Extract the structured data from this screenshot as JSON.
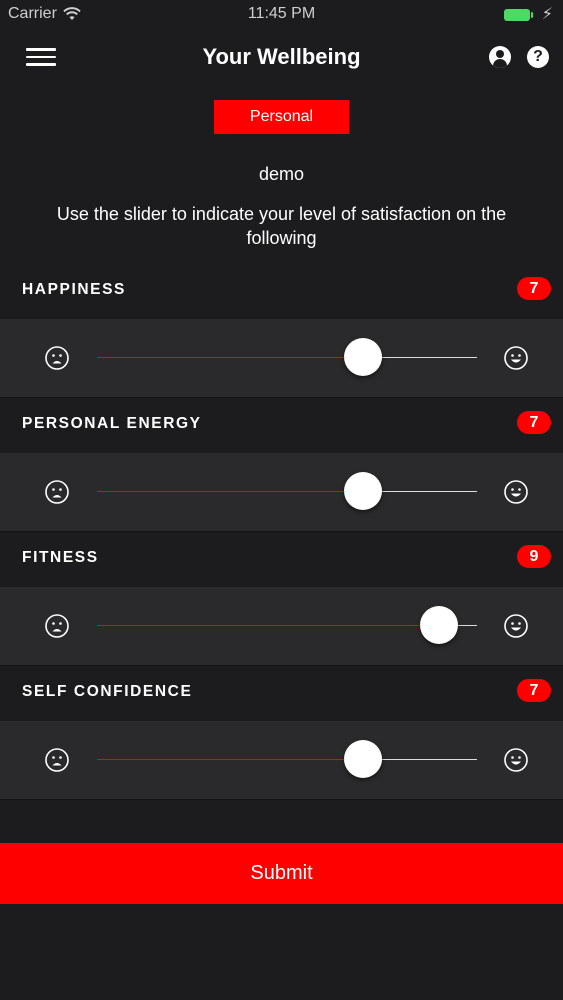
{
  "status_bar": {
    "carrier": "Carrier",
    "time": "11:45 PM",
    "battery_color": "#4cd964"
  },
  "nav": {
    "title": "Your Wellbeing",
    "menu_icon": "hamburger-menu-icon",
    "user_icon": "user-profile-icon",
    "help_icon": "help-icon",
    "help_glyph": "?"
  },
  "category_button": "Personal",
  "username": "demo",
  "instructions": "Use the slider to indicate your level of satisfaction on the following",
  "ratings": [
    {
      "label": "HAPPINESS",
      "value": "7",
      "level": 0.7
    },
    {
      "label": "PERSONAL ENERGY",
      "value": "7",
      "level": 0.7
    },
    {
      "label": "FITNESS",
      "value": "9",
      "level": 0.9
    },
    {
      "label": "SELF CONFIDENCE",
      "value": "7",
      "level": 0.7
    }
  ],
  "slider_min_icon": "sad-face-icon",
  "slider_max_icon": "happy-face-icon",
  "submit_label": "Submit",
  "accent_color": "#ff0000"
}
